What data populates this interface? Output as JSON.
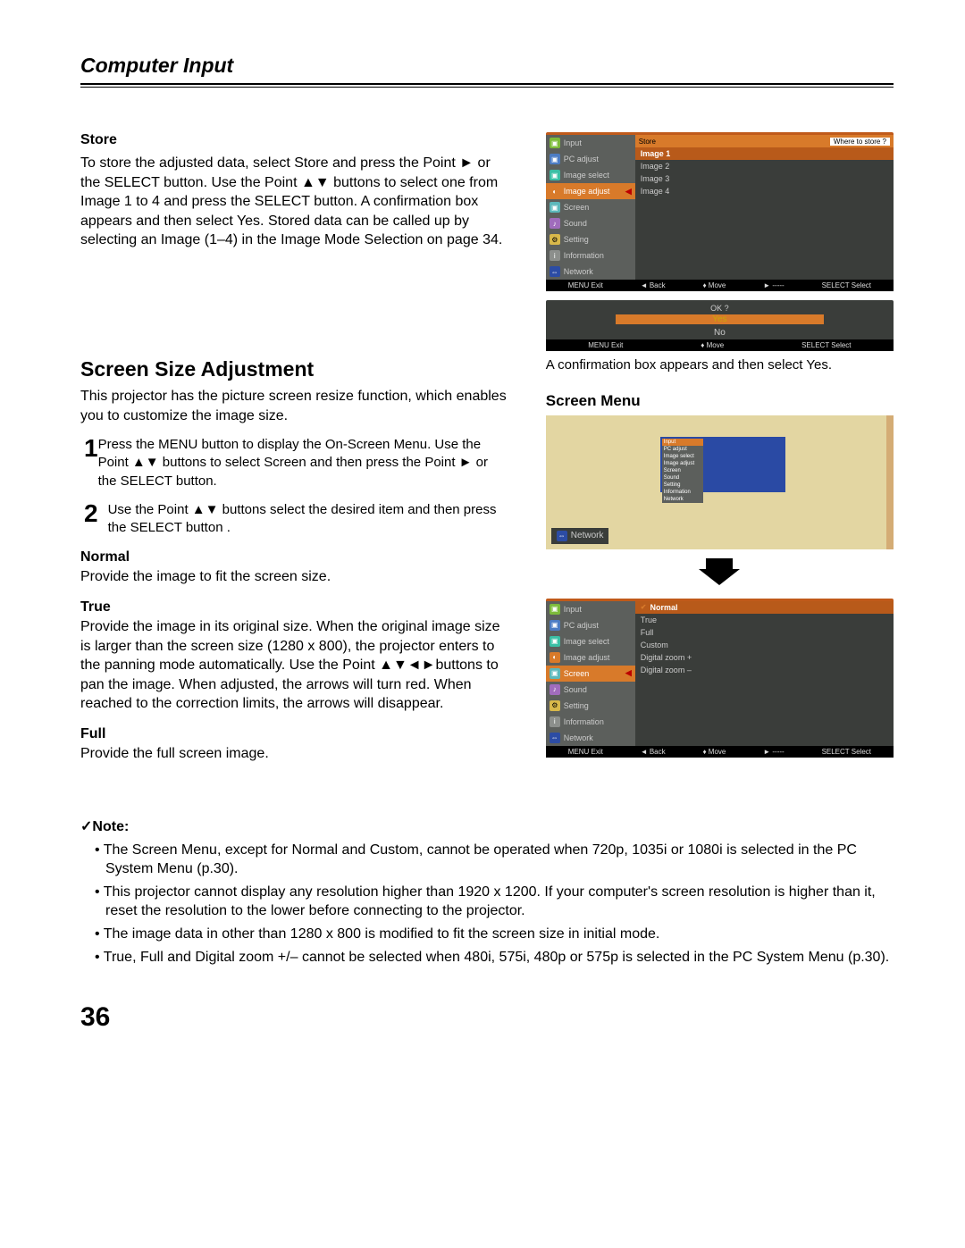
{
  "page_title": "Computer Input",
  "store": {
    "heading": "Store",
    "text": "To store the adjusted data, select Store and press the Point ► or the SELECT button. Use the Point ▲▼ buttons to select one from Image 1 to 4 and press the SELECT button. A confirmation box appears and then select Yes. Stored data can be called up by selecting an Image (1–4) in the Image Mode Selection on page 34."
  },
  "osd_store": {
    "side_items": [
      "Input",
      "PC adjust",
      "Image select",
      "Image adjust",
      "Screen",
      "Sound",
      "Setting",
      "Information",
      "Network"
    ],
    "side_active_index": 3,
    "main_bar_left": "Store",
    "main_bar_right": "Where to store ?",
    "main_items": [
      "Image 1",
      "Image 2",
      "Image 3",
      "Image 4"
    ],
    "main_hl_index": 0,
    "hints": [
      "MENU Exit",
      "◄ Back",
      "♦ Move",
      "► -----",
      "SELECT Select"
    ]
  },
  "osd_confirm": {
    "title": "OK ?",
    "yes": "Yes",
    "no": "No",
    "hints": [
      "MENU Exit",
      "♦ Move",
      "SELECT Select"
    ],
    "caption": "A confirmation box appears and then select Yes."
  },
  "screen_size": {
    "heading": "Screen Size Adjustment",
    "intro": "This projector has the picture screen resize function, which enables you to customize the image size.",
    "steps": [
      "Press the MENU button to display the On-Screen Menu. Use the Point ▲▼ buttons to select Screen and then press the Point ► or the SELECT button.",
      "Use the Point ▲▼ buttons select the desired item and then press the SELECT button ."
    ],
    "options": [
      {
        "head": "Normal",
        "text": "Provide the image to fit the screen size."
      },
      {
        "head": "True",
        "text": "Provide the image in its original size. When the original image size is larger than the screen size (1280 x 800), the projector enters to the panning mode automatically. Use the Point ▲▼◄►buttons to pan the image. When adjusted, the arrows will turn red. When reached to the correction limits, the arrows will disappear."
      },
      {
        "head": "Full",
        "text": "Provide the full screen image."
      }
    ]
  },
  "screen_menu": {
    "heading": "Screen Menu",
    "network_badge": "Network"
  },
  "osd_screen": {
    "side_items": [
      "Input",
      "PC adjust",
      "Image select",
      "Image adjust",
      "Screen",
      "Sound",
      "Setting",
      "Information",
      "Network"
    ],
    "side_active_index": 4,
    "main_items": [
      "Normal",
      "True",
      "Full",
      "Custom",
      "Digital zoom +",
      "Digital zoom –"
    ],
    "main_hl_index": 0,
    "hints": [
      "MENU Exit",
      "◄ Back",
      "♦ Move",
      "► -----",
      "SELECT Select"
    ]
  },
  "note": {
    "heading": "✓Note:",
    "items": [
      "The Screen Menu, except for Normal and Custom, cannot be operated when 720p, 1035i  or 1080i  is selected in the PC System Menu (p.30).",
      "This projector cannot display any resolution higher than 1920 x 1200. If your computer's screen resolution is higher than it, reset the resolution to the lower before connecting to the projector.",
      "The image data in other than 1280 x 800 is modified to fit the screen size in initial mode.",
      "True, Full and Digital zoom +/– cannot be selected when 480i, 575i, 480p or 575p is selected in the PC System Menu (p.30)."
    ]
  },
  "page_number": "36"
}
